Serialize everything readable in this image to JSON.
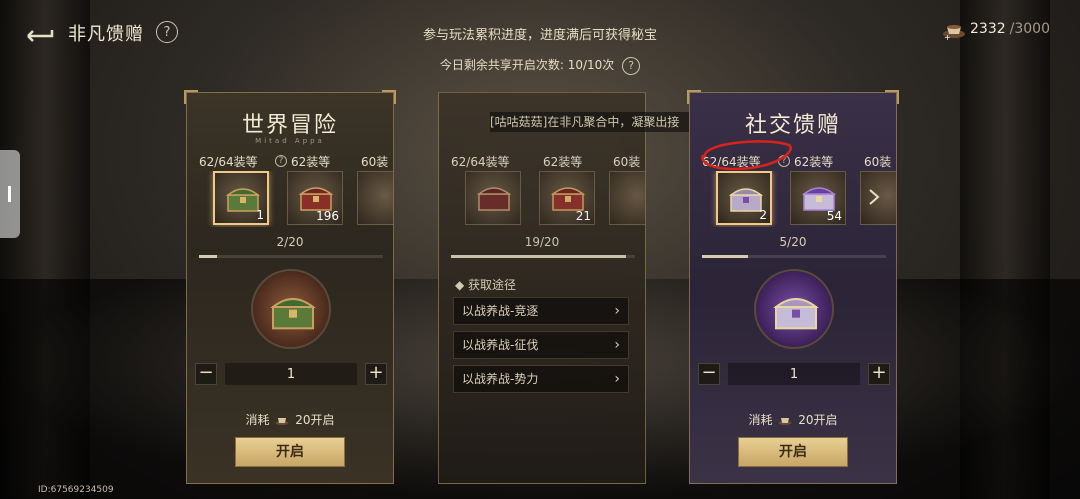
{
  "header": {
    "title": "非凡馈赠",
    "help": "?",
    "note": "参与玩法累积进度，进度满后可获得秘宝",
    "daily_label": "今日剩余共享开启次数: 10/10次",
    "daily_help": "?"
  },
  "currency": {
    "value": "2332",
    "max": "/3000"
  },
  "marquee": "[咕咕菇菇]在非凡聚合中，凝聚出接",
  "cards": [
    {
      "title": "世界冒险",
      "subtitle": "Mitad Appa",
      "tiers": [
        "62/64装等",
        "62装等",
        "60装"
      ],
      "tier_help": "?",
      "chests": [
        {
          "count": "1"
        },
        {
          "count": "196"
        }
      ],
      "progress_text": "2/20",
      "progress": 0.1,
      "qty_minus": "−",
      "qty_plus": "+",
      "qty_value": "1",
      "cost_prefix": "消耗",
      "cost_value": "20开启",
      "open_label": "开启"
    },
    {
      "title": "",
      "tiers": [
        "62/64装等",
        "62装等",
        "60装"
      ],
      "chests": [
        {
          "count": ""
        },
        {
          "count": "21"
        }
      ],
      "progress_text": "19/20",
      "progress": 0.95,
      "sources_title": "获取途径",
      "sources": [
        "以战养战-竞逐",
        "以战养战-征伐",
        "以战养战-势力"
      ],
      "source_chevron": "›"
    },
    {
      "title": "社交馈赠",
      "tiers": [
        "62/64装等",
        "62装等",
        "60装"
      ],
      "tier_help": "?",
      "chests": [
        {
          "count": "2"
        },
        {
          "count": "54"
        }
      ],
      "progress_text": "5/20",
      "progress": 0.25,
      "qty_minus": "−",
      "qty_plus": "+",
      "qty_value": "1",
      "cost_prefix": "消耗",
      "cost_value": "20开启",
      "open_label": "开启"
    }
  ],
  "id_label": "ID:67569234509",
  "colors": {
    "accent_gold": "#e9cf93",
    "annotation_red": "#d8231c"
  }
}
